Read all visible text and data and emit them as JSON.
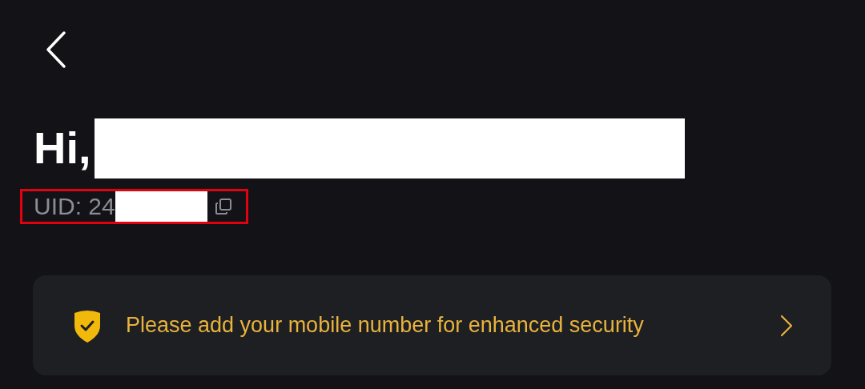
{
  "header": {
    "greeting": "Hi,",
    "uid_label": "UID: 24"
  },
  "security_banner": {
    "message": "Please add your mobile number for enhanced security"
  }
}
